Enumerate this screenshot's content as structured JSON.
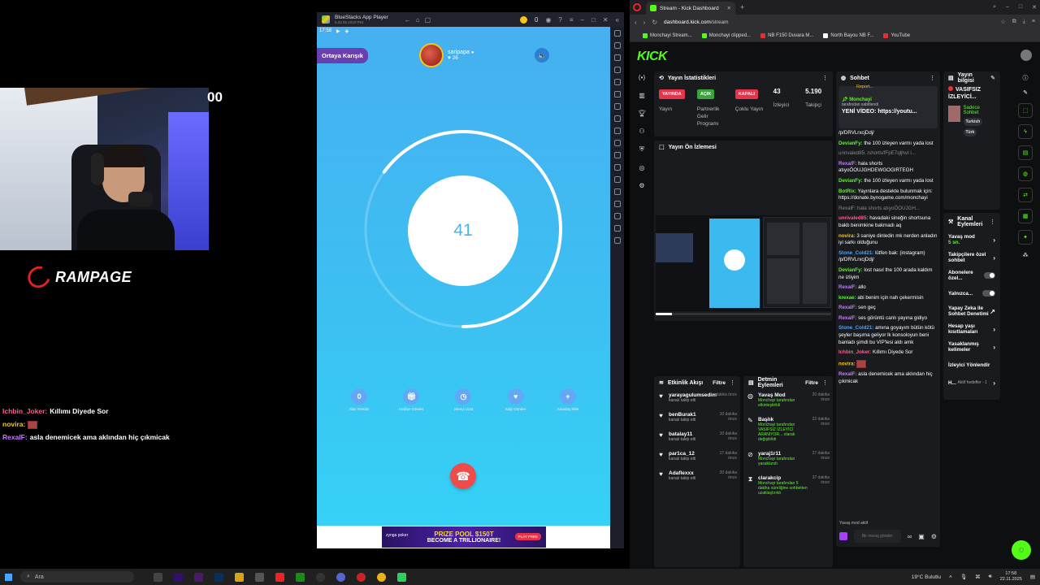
{
  "overlay": {
    "stream_number": "00",
    "brand": "RAMPAGE",
    "chat": [
      {
        "user": "Ichbin_Joker:",
        "user_color": "#ff5e8a",
        "text": "Kıllımı Diyede Sor"
      },
      {
        "user": "novira:",
        "user_color": "#f5c518",
        "text": ""
      },
      {
        "user": "RexalF:",
        "user_color": "#c978ff",
        "text": "asla denemicek ama aklından hiç çıkmicak"
      }
    ]
  },
  "bluestacks": {
    "title": "BlueStacks App Player",
    "version": "5.22.55.1010 P64",
    "coins": "0",
    "status_time": "17:58",
    "mix_button": "Ortaya Karışık",
    "host_name": "saripapa",
    "host_likes": "26",
    "counter": "41",
    "counter_progress": 0.65,
    "actions": [
      {
        "icon": "0",
        "label": "Altın Gönder"
      },
      {
        "icon": "gift-icon",
        "label": "Hediye Gönder"
      },
      {
        "icon": "clock-icon",
        "label": "Süreyi Uzat"
      },
      {
        "icon": "heart-icon",
        "label": "Kalp Gönder"
      },
      {
        "icon": "plus-icon",
        "label": "Arkadaş Ekle"
      }
    ],
    "ad": {
      "brand": "zynga poker",
      "line1": "PRIZE POOL $150T",
      "line2": "BECOME A TRILLIONAIRE!",
      "cta": "PLAY FREE"
    }
  },
  "browser": {
    "tab_title": "Stream - Kick Dashboard",
    "url_domain": "dashboard.kick.com",
    "url_path": "/stream",
    "bookmarks": [
      "Monchayi Stream...",
      "Monchayi clipped...",
      "NB F150 Duvara M...",
      "North Bayou NB F...",
      "YouTube"
    ]
  },
  "kick": {
    "logo": "KICK",
    "stats": {
      "title": "Yayın İstatistikleri",
      "items": [
        {
          "pill": "YAYINDA",
          "pill_color": "#e8344b",
          "label": "Yayın"
        },
        {
          "pill": "AÇIK",
          "pill_color": "#3aa53a",
          "label": "Partnerlik Gelir Programı"
        },
        {
          "pill": "KAPALI",
          "pill_color": "#e8344b",
          "label": "Çoklu Yayın"
        },
        {
          "value": "43",
          "label": "İzleyici"
        },
        {
          "value": "5.190",
          "label": "Takipçi"
        }
      ]
    },
    "preview_title": "Yayın Ön İzlemesi",
    "activity": {
      "title": "Etkinlik Akışı",
      "filter": "Filtre",
      "items": [
        {
          "icon": "heart-icon",
          "name": "yarayagulumsedim",
          "sub": "kanalı takip etti",
          "time": "dakika önce"
        },
        {
          "icon": "heart-icon",
          "name": "benBurak1",
          "sub": "kanalı takip etti",
          "time": "10 dakika önce"
        },
        {
          "icon": "heart-icon",
          "name": "batalay11",
          "sub": "kanalı takip etti",
          "time": "10 dakika önce"
        },
        {
          "icon": "heart-icon",
          "name": "par1ca_12",
          "sub": "kanalı takip etti",
          "time": "17 dakika önce"
        },
        {
          "icon": "heart-icon",
          "name": "Adaflexxx",
          "sub": "kanalı takip etti",
          "time": "20 dakika önce"
        }
      ]
    },
    "stream_actions": {
      "title": "Detmin Eylemleri",
      "filter": "Filtre",
      "items": [
        {
          "icon": "chat-icon",
          "name": "Yavaş Mod",
          "by": "Monchayi tarafından etkinleştirildi",
          "time": "20 dakika önce"
        },
        {
          "icon": "edit-icon",
          "name": "Başlık",
          "by": "Monchayi tarafından VASIFSIZ İZLEYİCİ ARANIYOR... olarak değiştirildi",
          "time": "22 dakika önce"
        },
        {
          "icon": "ban-icon",
          "name": "yaraj1r11",
          "by": "Monchayi tarafından yasaklandı",
          "time": "27 dakika önce"
        },
        {
          "icon": "timer-icon",
          "name": "clarakcip",
          "by": "Monchayi tarafından 5 dakika süreliğine sohbetten uzaklaştırıldı",
          "time": "37 dakika önce"
        }
      ]
    },
    "chat": {
      "title": "Sohbet",
      "report": "Report...",
      "pinned_user": "Monchayi",
      "pinned_label": "tarafından sabitlendi",
      "pinned_msg": "YENİ VİDEO: https://youtu...",
      "messages": [
        {
          "user": "",
          "color": "#fff",
          "text": "/p/DRVLrxcjDdj/"
        },
        {
          "user": "DevianFy:",
          "color": "#53fc18",
          "text": "the 100 izleyen varmı yada lost"
        },
        {
          "user": "",
          "color": "#888",
          "text": "unrivaled85: /shorts/fFpE7qljhvI i..."
        },
        {
          "user": "RexalF:",
          "color": "#c978ff",
          "text": "hala shorts atıyoÖOUJGHDEWGOGIRTEGH"
        },
        {
          "user": "DevianFy:",
          "color": "#53fc18",
          "text": "the 100 izleyen varmı yada lost"
        },
        {
          "user": "BotRix:",
          "color": "#53fc18",
          "text": "Yayınlara destekte bulunmak için: https://donate.bynogame.com/monchayi"
        },
        {
          "user": "",
          "color": "#888",
          "text": "RexalF: hala shorts atıyoÖOUJGH..."
        },
        {
          "user": "unrivaled85:",
          "color": "#ff5e8a",
          "text": "havadaki sineğin shortsuna bakb benimkine bakmadı aq"
        },
        {
          "user": "novira:",
          "color": "#f5c518",
          "text": "3 saniye dinledin mk nerden anladın iyi sarkı olduğunu"
        },
        {
          "user": "Stone_Cold21:",
          "color": "#4aa3ff",
          "text": "lütfen bak: (instagram) /p/DRVLrxcjDdj/"
        },
        {
          "user": "DevianFy:",
          "color": "#53fc18",
          "text": "lost nasıl the 100 arada kaldım ne izliyim"
        },
        {
          "user": "RexalF:",
          "color": "#c978ff",
          "text": "allo"
        },
        {
          "user": "krexae:",
          "color": "#53fc18",
          "text": "abi benim için nah çekermisin"
        },
        {
          "user": "RexalF:",
          "color": "#c978ff",
          "text": "sen geç"
        },
        {
          "user": "RexalF:",
          "color": "#c978ff",
          "text": "ses görüntü canlı yayına gidiyo"
        },
        {
          "user": "Stone_Cold21:",
          "color": "#4aa3ff",
          "text": "amına goyayım bütün kötü şeyler başıma geliyor lk konsoloyun beni banladı şimdi bu VIP'lesi aldı amk"
        },
        {
          "user": "Ichbin_Joker:",
          "color": "#ff5e8a",
          "text": "Kıllımı Diyede Sor"
        },
        {
          "user": "novira:",
          "color": "#f5c518",
          "text": ""
        },
        {
          "user": "RexalF:",
          "color": "#c978ff",
          "text": "asla denemicek ama aklından hiç çıkmicak"
        }
      ],
      "slow_mode": "Yavaş mod aktif",
      "input_placeholder": "Bir mesaj gönder"
    },
    "info": {
      "title": "Yayın bilgisi",
      "live_title": "VASIFSIZ İZLEYİCİ...",
      "category": "Sadece Sohbet",
      "tags": [
        "Turkish",
        "Türk"
      ]
    },
    "channel": {
      "title": "Kanal Eylemleri",
      "rows": [
        {
          "label": "Yavaş mod",
          "sub": "5 sn.",
          "control": "arrow"
        },
        {
          "label": "Takipçilere özel sohbet",
          "control": "arrow"
        },
        {
          "label": "Abonelere özel...",
          "control": "toggle"
        },
        {
          "label": "Yalnızca...",
          "control": "toggle"
        },
        {
          "label": "Yapay Zeka ile Sohbet Denetimi",
          "control": "link"
        },
        {
          "label": "Hesap yaşı kısıtlamaları",
          "control": "arrow"
        },
        {
          "label": "Yasaklanmış kelimeler",
          "control": "arrow"
        },
        {
          "label": "İzleyici Yönlendir",
          "control": "none"
        },
        {
          "label": "H...",
          "sub": "Aktif hedefler - 1",
          "control": "arrow"
        }
      ]
    }
  },
  "taskbar": {
    "search_placeholder": "Ara",
    "weather": "19°C Bulutlu",
    "time": "17:58",
    "date": "22.11.2025"
  }
}
